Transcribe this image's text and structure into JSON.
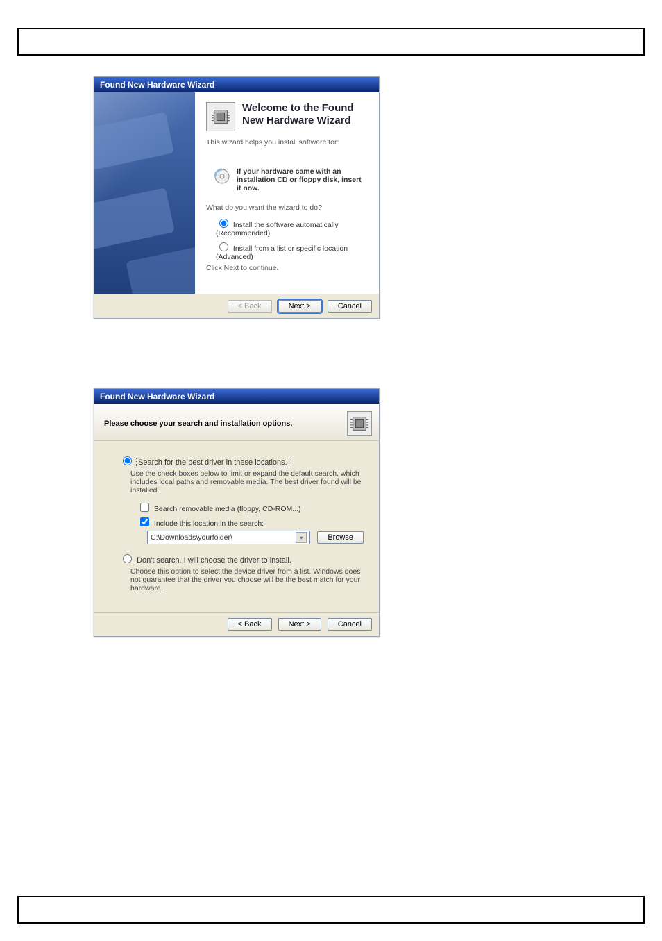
{
  "wizard1": {
    "title": "Found New Hardware Wizard",
    "heading": "Welcome to the Found New Hardware Wizard",
    "intro": "This wizard helps you install software for:",
    "cd_hint": "If your hardware came with an installation CD or floppy disk, insert it now.",
    "question": "What do you want the wizard to do?",
    "opt_auto": "Install the software automatically (Recommended)",
    "opt_adv": "Install from a list or specific location (Advanced)",
    "continue_hint": "Click Next to continue.",
    "btn_back": "< Back",
    "btn_next": "Next >",
    "btn_cancel": "Cancel"
  },
  "wizard2": {
    "title": "Found New Hardware Wizard",
    "subtitle": "Please choose your search and installation options.",
    "opt_search": "Search for the best driver in these locations.",
    "search_desc": "Use the check boxes below to limit or expand the default search, which includes local paths and removable media. The best driver found will be installed.",
    "chk_media": "Search removable media (floppy, CD-ROM...)",
    "chk_include": "Include this location in the search:",
    "path_value": "C:\\Downloads\\yourfolder\\",
    "btn_browse": "Browse",
    "opt_dont": "Don't search. I will choose the driver to install.",
    "dont_desc": "Choose this option to select the device driver from a list.  Windows does not guarantee that the driver you choose will be the best match for your hardware.",
    "btn_back": "< Back",
    "btn_next": "Next >",
    "btn_cancel": "Cancel"
  }
}
